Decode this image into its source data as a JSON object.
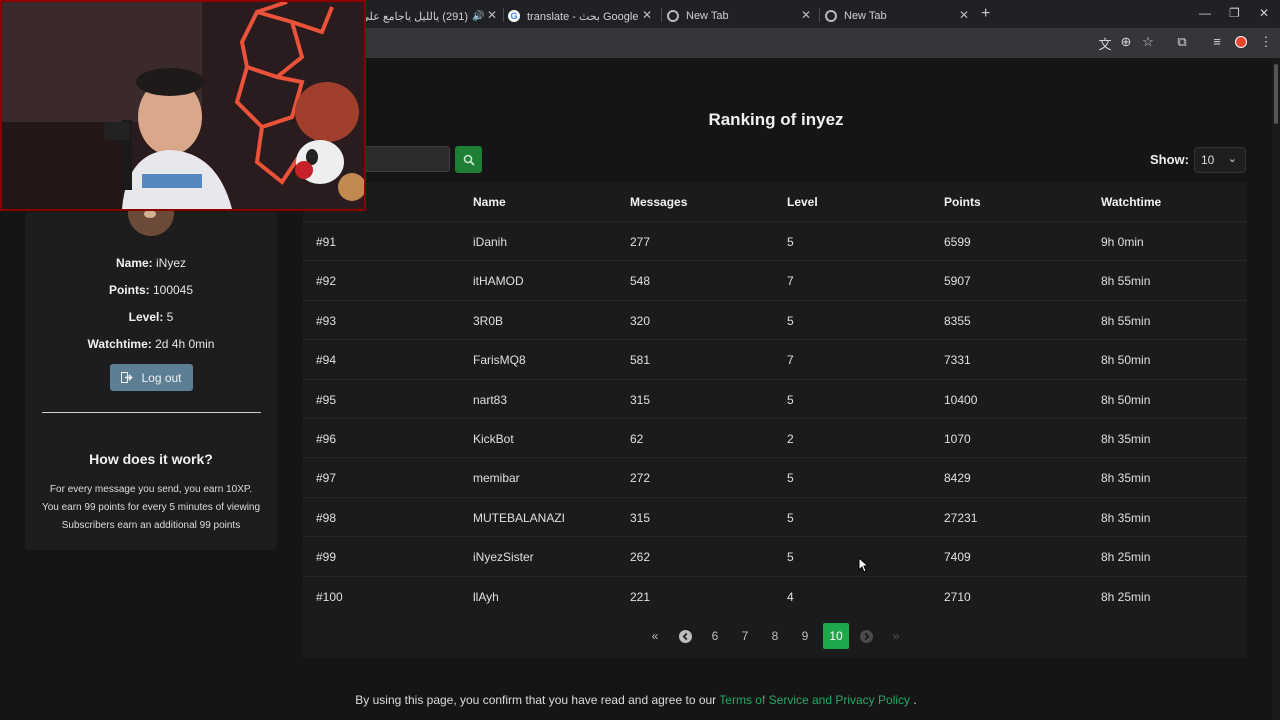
{
  "browser": {
    "tabs": [
      {
        "title": "(291) يالليل ياجامع على الود ..",
        "icon": "audio-icon"
      },
      {
        "title": "translate - بحث Google",
        "icon": "google-icon"
      },
      {
        "title": "New Tab",
        "icon": "chrome-icon"
      },
      {
        "title": "New Tab",
        "icon": "chrome-icon"
      }
    ],
    "new_tab": "+",
    "window_controls": {
      "minimize": "—",
      "restore": "❐",
      "close": "✕"
    },
    "toolbar_icons": [
      "translate-icon",
      "zoom-icon",
      "star-icon",
      "extensions-icon",
      "media-icon",
      "profile-icon",
      "menu-icon"
    ]
  },
  "page": {
    "title": "Ranking of inyez",
    "search": {
      "placeholder": "",
      "button_icon": "search-icon"
    },
    "show": {
      "label": "Show:",
      "value": "10"
    }
  },
  "sidebar": {
    "name_label": "Name:",
    "name_value": " iNyez",
    "points_label": "Points:",
    "points_value": " 100045",
    "level_label": "Level:",
    "level_value": " 5",
    "watchtime_label": "Watchtime:",
    "watchtime_value": " 2d 4h 0min",
    "logout_label": "Log out",
    "how_title": "How does it work?",
    "how_lines": [
      "For every message you send, you earn 10XP.",
      "You earn 99 points for every 5 minutes of viewing",
      "Subscribers earn an additional 99 points"
    ]
  },
  "table": {
    "headers": [
      "",
      "Name",
      "Messages",
      "Level",
      "Points",
      "Watchtime"
    ],
    "rows": [
      [
        "#91",
        "iDanih",
        "277",
        "5",
        "6599",
        "9h 0min"
      ],
      [
        "#92",
        "itHAMOD",
        "548",
        "7",
        "5907",
        "8h 55min"
      ],
      [
        "#93",
        "3R0B",
        "320",
        "5",
        "8355",
        "8h 55min"
      ],
      [
        "#94",
        "FarisMQ8",
        "581",
        "7",
        "7331",
        "8h 50min"
      ],
      [
        "#95",
        "nart83",
        "315",
        "5",
        "10400",
        "8h 50min"
      ],
      [
        "#96",
        "KickBot",
        "62",
        "2",
        "1070",
        "8h 35min"
      ],
      [
        "#97",
        "memibar",
        "272",
        "5",
        "8429",
        "8h 35min"
      ],
      [
        "#98",
        "MUTEBALANAZI",
        "315",
        "5",
        "27231",
        "8h 35min"
      ],
      [
        "#99",
        "iNyezSister",
        "262",
        "5",
        "7409",
        "8h 25min"
      ],
      [
        "#100",
        "llAyh",
        "221",
        "4",
        "2710",
        "8h 25min"
      ]
    ]
  },
  "pagination": {
    "first": "«",
    "prev": "‹",
    "pages": [
      "6",
      "7",
      "8",
      "9",
      "10"
    ],
    "active": "10",
    "next": "›",
    "last": "»"
  },
  "footer": {
    "text_before": "By using this page, you confirm that you have read and agree to our ",
    "link": "Terms of Service and Privacy Policy",
    "text_after": " ."
  },
  "colors": {
    "accent": "#1fa84a",
    "link": "#28a765",
    "logout": "#5d7f95",
    "webcam_border": "#8a0000"
  }
}
